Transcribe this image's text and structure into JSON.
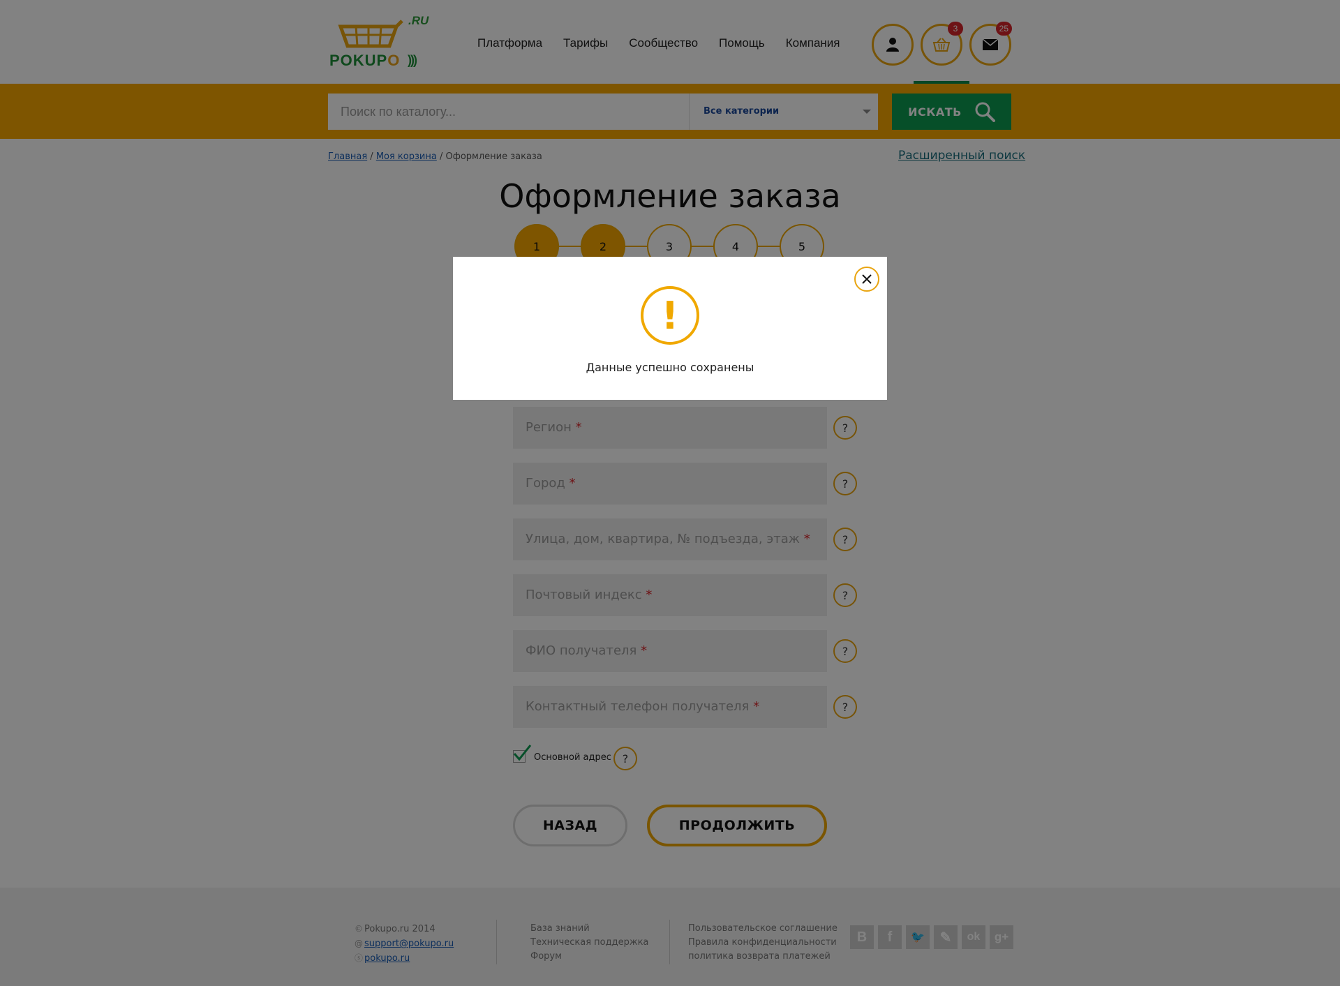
{
  "brand": {
    "logo_ru": ".RU",
    "logo_text_1": "POKUP",
    "logo_text_2": "O"
  },
  "nav": {
    "items": [
      {
        "label": "Платформа"
      },
      {
        "label": "Тарифы"
      },
      {
        "label": "Сообщество"
      },
      {
        "label": "Помощь"
      },
      {
        "label": "Компания"
      }
    ]
  },
  "header_icons": {
    "user_icon": "user-icon",
    "cart_icon": "basket-icon",
    "cart_count": "3",
    "mail_icon": "envelope-icon",
    "mail_count": "25"
  },
  "search": {
    "placeholder": "Поиск по каталогу...",
    "category": "Все категории",
    "button_label": "ИСКАТЬ"
  },
  "breadcrumb": {
    "home": "Главная",
    "sep1": " / ",
    "cart": "Моя корзина",
    "sep2": " / ",
    "current": "Оформление заказа"
  },
  "advanced_search": "Расширенный поиск",
  "page_title": "Оформление заказа",
  "steps": [
    "1",
    "2",
    "3",
    "4",
    "5"
  ],
  "active_steps": 2,
  "form": {
    "fields": [
      {
        "label": "Регион",
        "req": "*"
      },
      {
        "label": "Город",
        "req": "*"
      },
      {
        "label": "Улица, дом, квартира, № подъезда, этаж",
        "req": "*"
      },
      {
        "label": "Почтовый индекс",
        "req": "*"
      },
      {
        "label": "ФИО получателя",
        "req": "*"
      },
      {
        "label": "Контактный телефон получателя",
        "req": "*"
      }
    ],
    "help_label": "?",
    "checkbox_label": "Основной адрес",
    "checkbox_checked": true,
    "back_label": "НАЗАД",
    "next_label": "ПРОДОЛЖИТЬ"
  },
  "footer": {
    "copyright": "Pokupo.ru 2014",
    "email": "support@pokupo.ru",
    "skype": "pokupo.ru",
    "col2": [
      "База знаний",
      "Техническая поддержка",
      "Форум"
    ],
    "col3": [
      "Пользовательское соглашение",
      "Правила конфиденциальности",
      "политика возврата платежей"
    ],
    "social": [
      {
        "glyph": "B",
        "icon": "vk-icon"
      },
      {
        "glyph": "f",
        "icon": "facebook-icon"
      },
      {
        "glyph": "🐦",
        "icon": "twitter-icon"
      },
      {
        "glyph": "✎",
        "icon": "livejournal-icon"
      },
      {
        "glyph": "ok",
        "icon": "odnoklassniki-icon"
      },
      {
        "glyph": "g+",
        "icon": "google-plus-icon"
      }
    ]
  },
  "modal": {
    "message": "Данные успешно сохранены",
    "warn_glyph": "!"
  },
  "colors": {
    "accent": "#f7a800",
    "green": "#0d9b52",
    "badge": "#d8272b",
    "overlay": "rgba(0,0,0,0.49)"
  }
}
